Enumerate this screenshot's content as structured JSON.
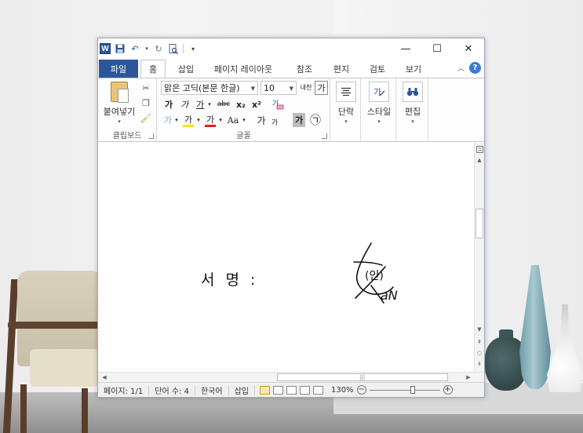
{
  "window": {
    "app_icon_letter": "W",
    "controls": {
      "minimize": "—",
      "maximize": "☐",
      "close": "✕"
    }
  },
  "tabs": {
    "file": "파일",
    "items": [
      {
        "label": "홈",
        "active": true
      },
      {
        "label": "삽입",
        "active": false
      },
      {
        "label": "페이지 레이아웃",
        "active": false
      },
      {
        "label": "참조",
        "active": false
      },
      {
        "label": "편지",
        "active": false
      },
      {
        "label": "검토",
        "active": false
      },
      {
        "label": "보기",
        "active": false
      }
    ],
    "help": "?"
  },
  "ribbon": {
    "clipboard": {
      "paste_label": "붙여넣기",
      "group_label": "클립보드"
    },
    "font": {
      "font_name": "맑은 고딕(본문 한글)",
      "font_size": "10",
      "btn_bold": "가",
      "btn_italic": "가",
      "btn_underline": "가",
      "btn_strike": "abc",
      "btn_subscript": "x₂",
      "btn_superscript": "x²",
      "btn_case": "Aa",
      "btn_grow": "가",
      "btn_shrink": "가",
      "btn_font_color": "가",
      "btn_highlight": "가",
      "btn_char_border": "가",
      "btn_enclose": "㉠",
      "btn_phonetic": "내천",
      "btn_char_shade": "가",
      "group_label": "글꼴",
      "colors": {
        "highlight": "#f5e800",
        "font_color": "#e02020"
      }
    },
    "paragraph": {
      "label": "단락"
    },
    "styles": {
      "label": "스타일"
    },
    "editing": {
      "label": "편집"
    }
  },
  "document": {
    "signature_label": "서 명 :",
    "signature_text": "(인)",
    "signature_tail": "aN"
  },
  "statusbar": {
    "page": "페이지: 1/1",
    "words": "단어 수: 4",
    "language": "한국어",
    "mode": "삽입",
    "zoom": "130%",
    "zoom_minus": "−",
    "zoom_plus": "+"
  }
}
